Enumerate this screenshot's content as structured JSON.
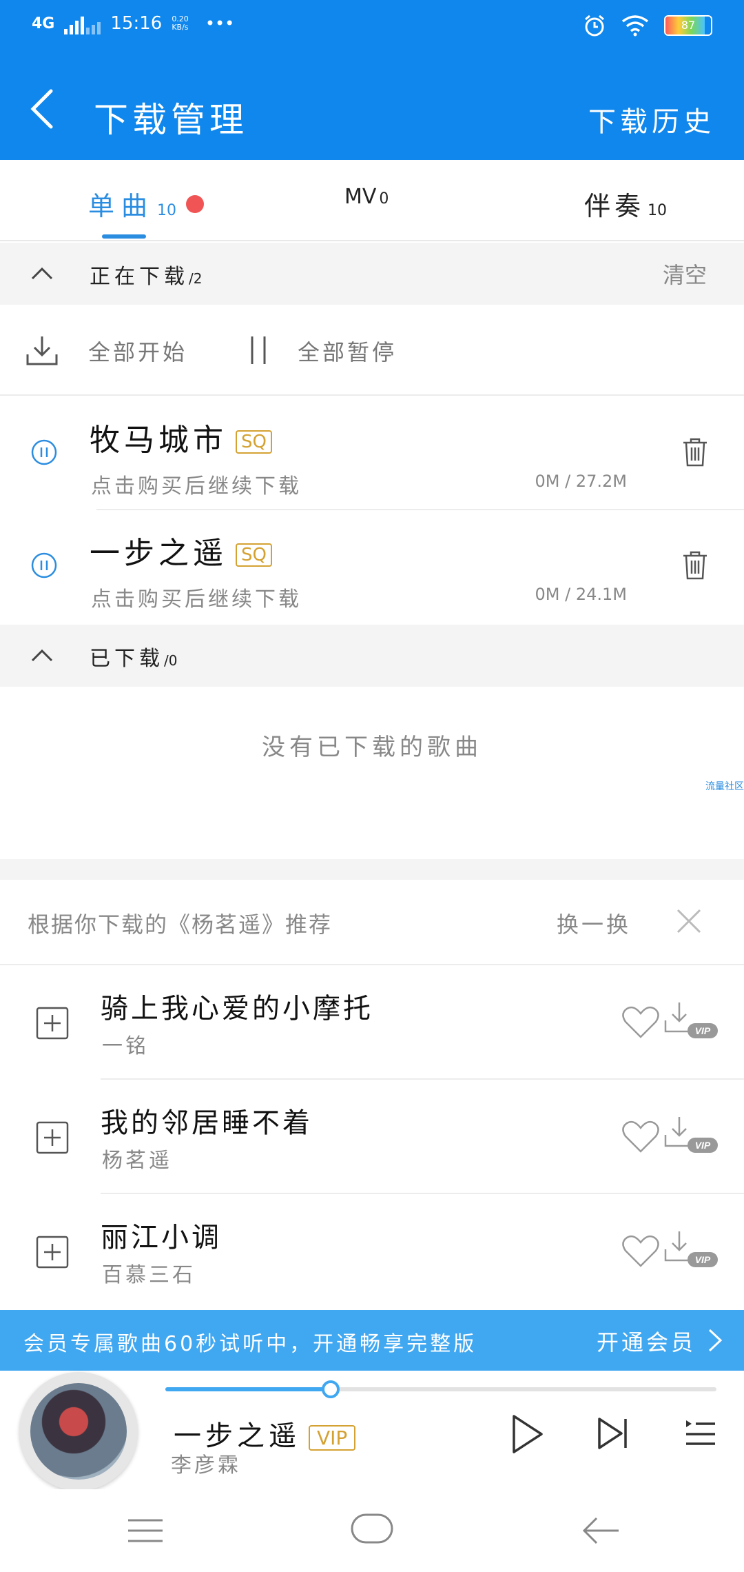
{
  "status": {
    "network": "4G",
    "time": "15:16",
    "speed_value": "0.20",
    "speed_unit": "KB/s",
    "more": "•••",
    "battery": "87"
  },
  "header": {
    "title": "下载管理",
    "history": "下载历史"
  },
  "tabs": [
    {
      "label": "单曲",
      "count": "10"
    },
    {
      "label": "MV",
      "count": "0"
    },
    {
      "label": "伴奏",
      "count": "10"
    }
  ],
  "downloading": {
    "label": "正在下载",
    "count": "/2",
    "clear": "清空",
    "start_all": "全部开始",
    "pause_all": "全部暂停",
    "items": [
      {
        "name": "牧马城市",
        "quality": "SQ",
        "note": "点击购买后继续下载",
        "size": "0M / 27.2M"
      },
      {
        "name": "一步之遥",
        "quality": "SQ",
        "note": "点击购买后继续下载",
        "size": "0M / 24.1M"
      }
    ]
  },
  "downloaded": {
    "label": "已下载",
    "count": "/0",
    "empty": "没有已下载的歌曲",
    "community": "流量社区"
  },
  "recommend": {
    "title": "根据你下载的《杨茗遥》推荐",
    "swap": "换一换",
    "items": [
      {
        "song": "骑上我心爱的小摩托",
        "artist": "一铭"
      },
      {
        "song": "我的邻居睡不着",
        "artist": "杨茗遥"
      },
      {
        "song": "丽江小调",
        "artist": "百慕三石"
      }
    ]
  },
  "vip_bar": {
    "text": "会员专属歌曲60秒试听中，开通畅享完整版",
    "action": "开通会员"
  },
  "player": {
    "song": "一步之遥",
    "badge": "VIP",
    "artist": "李彦霖",
    "progress": 0.3
  },
  "colors": {
    "brand": "#0f87ec",
    "accent": "#2b8de0",
    "quality": "#d4a233",
    "alert": "#f05454"
  }
}
